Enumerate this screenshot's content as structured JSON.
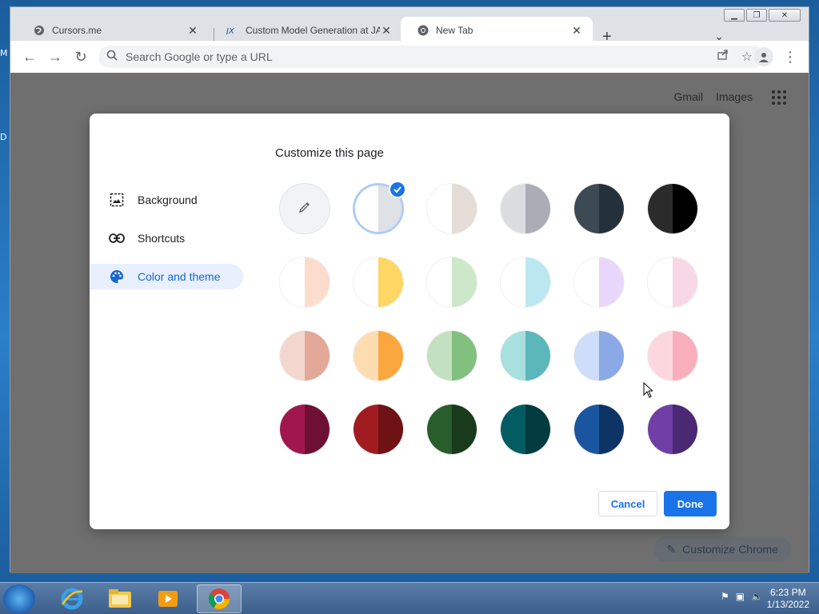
{
  "desktop": {
    "frag_top": "M",
    "frag_mid": "D"
  },
  "tabs": [
    {
      "title": "Cursors.me",
      "icon": "globe-icon"
    },
    {
      "title": "Custom Model Generation at JAX",
      "icon": "jax-icon"
    },
    {
      "title": "New Tab",
      "icon": "chrome-icon",
      "active": true
    }
  ],
  "toolbar": {
    "omnibox_placeholder": "Search Google or type a URL"
  },
  "ntp": {
    "gmail": "Gmail",
    "images": "Images",
    "customize_chrome": "Customize Chrome"
  },
  "dialog": {
    "title": "Customize this page",
    "nav": [
      {
        "label": "Background",
        "icon": "image-icon"
      },
      {
        "label": "Shortcuts",
        "icon": "link-icon"
      },
      {
        "label": "Color and theme",
        "icon": "palette-icon",
        "active": true
      }
    ],
    "swatches": [
      {
        "name": "custom-color",
        "left": "#f1f3f4",
        "right": "#f1f3f4",
        "custom": true
      },
      {
        "name": "default-white",
        "left": "#ffffff",
        "right": "#dee1e6",
        "selected": true
      },
      {
        "name": "warm-grey",
        "left": "#ffffff",
        "right": "#e3dcd7"
      },
      {
        "name": "cool-grey",
        "left": "#dadce0",
        "right": "#aaadb6"
      },
      {
        "name": "slate",
        "left": "#3c4a55",
        "right": "#25313a"
      },
      {
        "name": "black",
        "left": "#2b2b2b",
        "right": "#000000"
      },
      {
        "name": "peach-light",
        "left": "#ffffff",
        "right": "#fbdccd"
      },
      {
        "name": "yellow-light",
        "left": "#ffffff",
        "right": "#fdd663"
      },
      {
        "name": "green-light",
        "left": "#ffffff",
        "right": "#cde8c8"
      },
      {
        "name": "cyan-light",
        "left": "#ffffff",
        "right": "#bbe7f0"
      },
      {
        "name": "lavender-light",
        "left": "#ffffff",
        "right": "#e9d7fb"
      },
      {
        "name": "pink-light",
        "left": "#ffffff",
        "right": "#f8d8e6"
      },
      {
        "name": "rose",
        "left": "#f3d7cf",
        "right": "#e2a898"
      },
      {
        "name": "orange",
        "left": "#fddcb0",
        "right": "#f9a73e"
      },
      {
        "name": "green",
        "left": "#c3e1c1",
        "right": "#81c07d"
      },
      {
        "name": "teal",
        "left": "#a8dfdf",
        "right": "#5bb7ba"
      },
      {
        "name": "blue",
        "left": "#cdddfa",
        "right": "#8aa9e6"
      },
      {
        "name": "pink",
        "left": "#fcd7dd",
        "right": "#f9aebc"
      },
      {
        "name": "magenta-dark",
        "left": "#a0174e",
        "right": "#6e0f34"
      },
      {
        "name": "red-dark",
        "left": "#a11c21",
        "right": "#6e1215"
      },
      {
        "name": "green-dark",
        "left": "#285d2c",
        "right": "#1a3a1c"
      },
      {
        "name": "teal-dark",
        "left": "#045c63",
        "right": "#023b40"
      },
      {
        "name": "blue-dark",
        "left": "#1a56a0",
        "right": "#0e3466"
      },
      {
        "name": "purple-dark",
        "left": "#6f3fa5",
        "right": "#4b2873"
      }
    ],
    "cancel_label": "Cancel",
    "done_label": "Done"
  },
  "taskbar": {
    "time": "6:23 PM",
    "date": "1/13/2022"
  },
  "colors": {
    "accent": "#1a73e8",
    "nav_active_bg": "#e8f0fe"
  }
}
